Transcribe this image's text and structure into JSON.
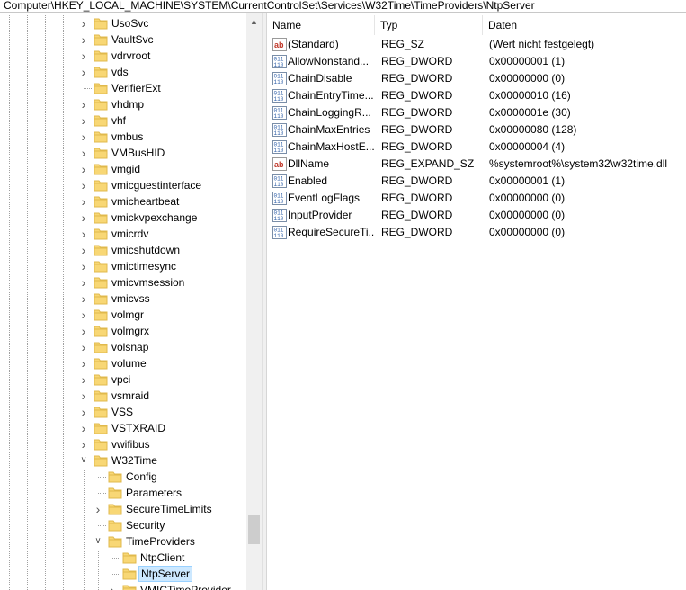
{
  "address_bar": {
    "path": "Computer\\HKEY_LOCAL_MACHINE\\SYSTEM\\CurrentControlSet\\Services\\W32Time\\TimeProviders\\NtpServer"
  },
  "tree": {
    "items": [
      {
        "label": "UsoSvc",
        "level": 0,
        "expand": "collapsed"
      },
      {
        "label": "VaultSvc",
        "level": 0,
        "expand": "collapsed"
      },
      {
        "label": "vdrvroot",
        "level": 0,
        "expand": "collapsed"
      },
      {
        "label": "vds",
        "level": 0,
        "expand": "collapsed"
      },
      {
        "label": "VerifierExt",
        "level": 0,
        "expand": "none"
      },
      {
        "label": "vhdmp",
        "level": 0,
        "expand": "collapsed"
      },
      {
        "label": "vhf",
        "level": 0,
        "expand": "collapsed"
      },
      {
        "label": "vmbus",
        "level": 0,
        "expand": "collapsed"
      },
      {
        "label": "VMBusHID",
        "level": 0,
        "expand": "collapsed"
      },
      {
        "label": "vmgid",
        "level": 0,
        "expand": "collapsed"
      },
      {
        "label": "vmicguestinterface",
        "level": 0,
        "expand": "collapsed"
      },
      {
        "label": "vmicheartbeat",
        "level": 0,
        "expand": "collapsed"
      },
      {
        "label": "vmickvpexchange",
        "level": 0,
        "expand": "collapsed"
      },
      {
        "label": "vmicrdv",
        "level": 0,
        "expand": "collapsed"
      },
      {
        "label": "vmicshutdown",
        "level": 0,
        "expand": "collapsed"
      },
      {
        "label": "vmictimesync",
        "level": 0,
        "expand": "collapsed"
      },
      {
        "label": "vmicvmsession",
        "level": 0,
        "expand": "collapsed"
      },
      {
        "label": "vmicvss",
        "level": 0,
        "expand": "collapsed"
      },
      {
        "label": "volmgr",
        "level": 0,
        "expand": "collapsed"
      },
      {
        "label": "volmgrx",
        "level": 0,
        "expand": "collapsed"
      },
      {
        "label": "volsnap",
        "level": 0,
        "expand": "collapsed"
      },
      {
        "label": "volume",
        "level": 0,
        "expand": "collapsed"
      },
      {
        "label": "vpci",
        "level": 0,
        "expand": "collapsed"
      },
      {
        "label": "vsmraid",
        "level": 0,
        "expand": "collapsed"
      },
      {
        "label": "VSS",
        "level": 0,
        "expand": "collapsed"
      },
      {
        "label": "VSTXRAID",
        "level": 0,
        "expand": "collapsed"
      },
      {
        "label": "vwifibus",
        "level": 0,
        "expand": "collapsed"
      },
      {
        "label": "W32Time",
        "level": 0,
        "expand": "expanded"
      },
      {
        "label": "Config",
        "level": 1,
        "expand": "none"
      },
      {
        "label": "Parameters",
        "level": 1,
        "expand": "none"
      },
      {
        "label": "SecureTimeLimits",
        "level": 1,
        "expand": "collapsed"
      },
      {
        "label": "Security",
        "level": 1,
        "expand": "none"
      },
      {
        "label": "TimeProviders",
        "level": 1,
        "expand": "expanded"
      },
      {
        "label": "NtpClient",
        "level": 2,
        "expand": "none"
      },
      {
        "label": "NtpServer",
        "level": 2,
        "expand": "none",
        "selected": true
      },
      {
        "label": "VMICTimeProvider",
        "level": 2,
        "expand": "collapsed"
      }
    ]
  },
  "list": {
    "columns": {
      "name": "Name",
      "type": "Typ",
      "data": "Daten"
    },
    "rows": [
      {
        "icon": "string-value-icon",
        "name": "(Standard)",
        "type": "REG_SZ",
        "data": "(Wert nicht festgelegt)"
      },
      {
        "icon": "binary-value-icon",
        "name": "AllowNonstand...",
        "type": "REG_DWORD",
        "data": "0x00000001 (1)"
      },
      {
        "icon": "binary-value-icon",
        "name": "ChainDisable",
        "type": "REG_DWORD",
        "data": "0x00000000 (0)"
      },
      {
        "icon": "binary-value-icon",
        "name": "ChainEntryTime...",
        "type": "REG_DWORD",
        "data": "0x00000010 (16)"
      },
      {
        "icon": "binary-value-icon",
        "name": "ChainLoggingR...",
        "type": "REG_DWORD",
        "data": "0x0000001e (30)"
      },
      {
        "icon": "binary-value-icon",
        "name": "ChainMaxEntries",
        "type": "REG_DWORD",
        "data": "0x00000080 (128)"
      },
      {
        "icon": "binary-value-icon",
        "name": "ChainMaxHostE...",
        "type": "REG_DWORD",
        "data": "0x00000004 (4)"
      },
      {
        "icon": "string-value-icon",
        "name": "DllName",
        "type": "REG_EXPAND_SZ",
        "data": "%systemroot%\\system32\\w32time.dll"
      },
      {
        "icon": "binary-value-icon",
        "name": "Enabled",
        "type": "REG_DWORD",
        "data": "0x00000001 (1)"
      },
      {
        "icon": "binary-value-icon",
        "name": "EventLogFlags",
        "type": "REG_DWORD",
        "data": "0x00000000 (0)"
      },
      {
        "icon": "binary-value-icon",
        "name": "InputProvider",
        "type": "REG_DWORD",
        "data": "0x00000000 (0)"
      },
      {
        "icon": "binary-value-icon",
        "name": "RequireSecureTi...",
        "type": "REG_DWORD",
        "data": "0x00000000 (0)"
      }
    ]
  },
  "scrollbar": {
    "position": 0.87,
    "visible_fraction": 0.05
  },
  "colors": {
    "folder": "#f8d775",
    "folder_dark": "#e0b94c",
    "selection_bg": "#cce8ff",
    "selection_border": "#99d1ff",
    "string_icon_red": "#c0392b",
    "binary_icon_blue": "#2d5fa8"
  }
}
